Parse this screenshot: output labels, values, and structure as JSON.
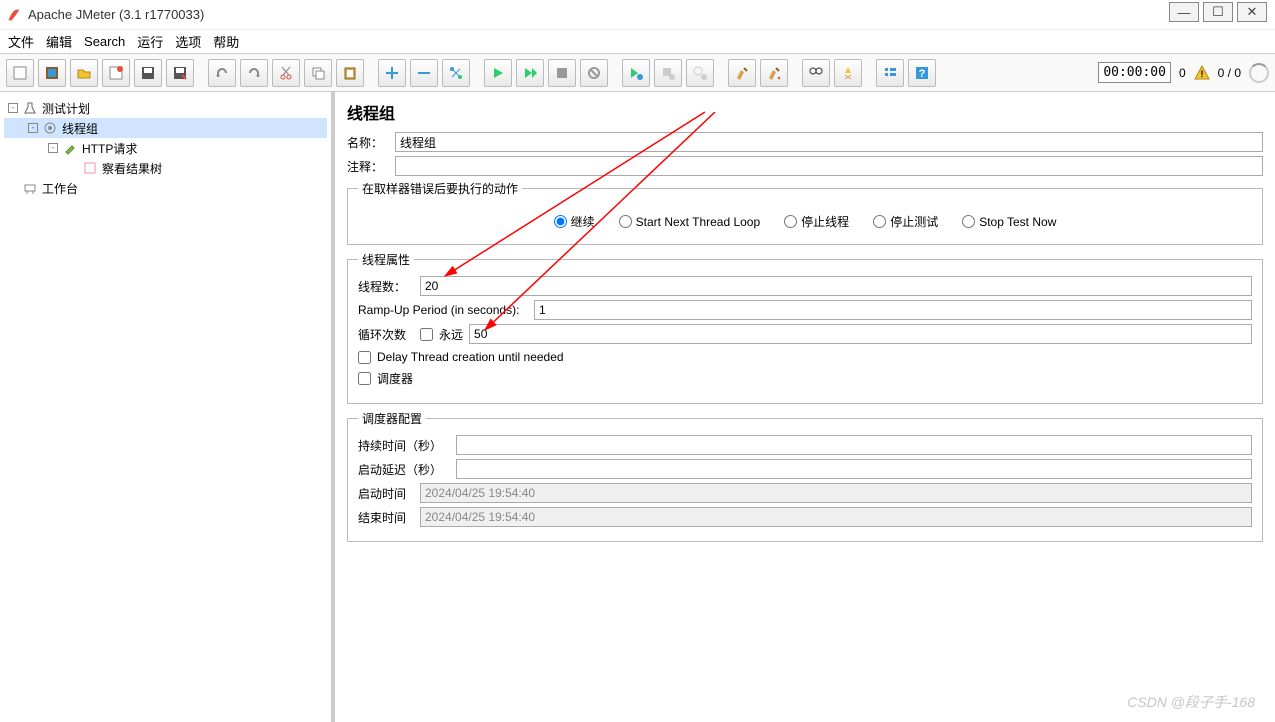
{
  "window": {
    "title": "Apache JMeter (3.1 r1770033)"
  },
  "menu": {
    "file": "文件",
    "edit": "编辑",
    "search": "Search",
    "run": "运行",
    "options": "选项",
    "help": "帮助"
  },
  "status": {
    "timer": "00:00:00",
    "warn_count": "0",
    "active": "0 / 0"
  },
  "tree": {
    "test_plan": "测试计划",
    "thread_group": "线程组",
    "http_request": "HTTP请求",
    "results_tree": "察看结果树",
    "workbench": "工作台"
  },
  "panel": {
    "title": "线程组",
    "name_label": "名称：",
    "name_value": "线程组",
    "comment_label": "注释：",
    "comment_value": "",
    "error_group": "在取样器错误后要执行的动作",
    "radios": {
      "continue": "继续",
      "start_next": "Start Next Thread Loop",
      "stop_thread": "停止线程",
      "stop_test": "停止测试",
      "stop_now": "Stop Test Now"
    },
    "props_group": "线程属性",
    "threads_label": "线程数：",
    "threads_value": "20",
    "rampup_label": "Ramp-Up Period (in seconds):",
    "rampup_value": "1",
    "loop_label": "循环次数",
    "forever_label": "永远",
    "loop_value": "50",
    "delay_label": "Delay Thread creation until needed",
    "scheduler_label": "调度器",
    "sched_group": "调度器配置",
    "duration_label": "持续时间（秒）",
    "startup_delay_label": "启动延迟（秒）",
    "start_time_label": "启动时间",
    "start_time_value": "2024/04/25 19:54:40",
    "end_time_label": "结束时间",
    "end_time_value": "2024/04/25 19:54:40"
  },
  "watermark": "CSDN @段子手-168"
}
